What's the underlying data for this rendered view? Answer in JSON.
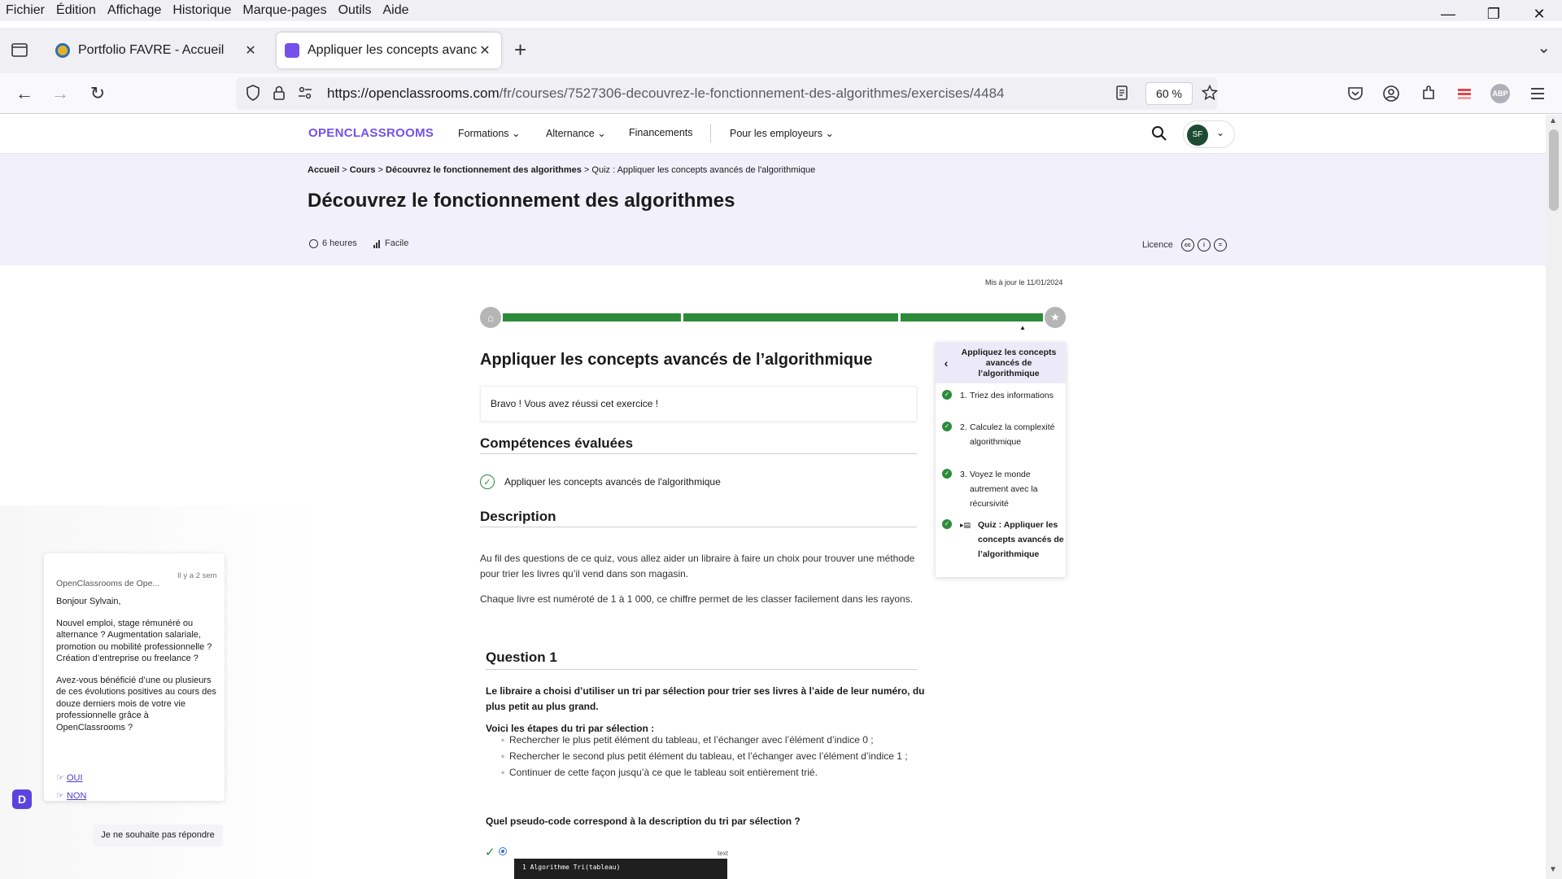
{
  "browser": {
    "menu": [
      "Fichier",
      "Édition",
      "Affichage",
      "Historique",
      "Marque-pages",
      "Outils",
      "Aide"
    ],
    "tabs": [
      {
        "title": "Portfolio FAVRE - Accueil",
        "favicon_color": "#e2b12a"
      },
      {
        "title": "Appliquer les concepts avancés",
        "favicon_color": "#7451eb"
      }
    ],
    "url_host": "https://openclassrooms.com",
    "url_path": "/fr/courses/7527306-decouvrez-le-fonctionnement-des-algorithmes/exercises/4484",
    "zoom": "60 %",
    "ext_label": "ABP"
  },
  "site": {
    "logo": "OPENCLASSROOMS",
    "nav": [
      "Formations",
      "Alternance",
      "Financements",
      "Pour les employeurs"
    ],
    "avatar": "SF",
    "brand_color": "#7451eb"
  },
  "hero": {
    "crumb_accueil": "Accueil",
    "crumb_cours": "Cours",
    "crumb_course": "Découvrez le fonctionnement des algorithmes",
    "crumb_current": "Quiz : Appliquer les concepts avancés de l'algorithmique",
    "title": "Découvrez le fonctionnement des algorithmes",
    "duration": "6 heures",
    "level": "Facile",
    "licence": "Licence"
  },
  "exercise": {
    "updated": "Mis à jour le 11/01/2024",
    "progress_segments": 3,
    "title": "Appliquer les concepts avancés de l’algorithmique",
    "success": "Bravo ! Vous avez réussi cet exercice !",
    "skills_heading": "Compétences évaluées",
    "skill": "Appliquer les concepts avancés de l'algorithmique",
    "description_heading": "Description",
    "description_1": "Au fil des questions de ce quiz, vous allez aider un libraire à faire un choix pour trouver une méthode pour trier les livres qu’il vend dans son magasin.",
    "description_2": "Chaque livre est numéroté de 1 à 1 000, ce chiffre permet de les classer facilement dans les rayons.",
    "question_title": "Question 1",
    "question_intro": "Le libraire a choisi d’utiliser un tri par sélection pour trier ses livres à l’aide de leur numéro, du plus petit au plus grand.",
    "steps_label": "Voici les étapes du tri par sélection :",
    "steps": [
      "Rechercher le plus petit élément du tableau, et l’échanger avec l’élément d’indice 0 ;",
      "Rechercher le second plus petit élément du tableau, et l’échanger avec l’élément d’indice 1 ;",
      "Continuer de cette façon jusqu’à ce que le tableau soit entièrement trié."
    ],
    "question": "Quel pseudo-code correspond à la description du tri par sélection ?",
    "code_label": "text",
    "code_line": "1  Algorithme Tri(tableau)"
  },
  "sidebar": {
    "heading": "Appliquez les concepts avancés de l’algorithmique",
    "items": [
      {
        "num": "1.",
        "label": "Triez des informations"
      },
      {
        "num": "2.",
        "label": "Calculez la complexité algorithmique"
      },
      {
        "num": "3.",
        "label": "Voyez le monde autrement avec la récursivité"
      },
      {
        "num": "",
        "label": "Quiz : Appliquer les concepts avancés de l’algorithmique"
      }
    ]
  },
  "chat": {
    "from": "OpenClassrooms de Ope...",
    "when": "Il y a 2 sem",
    "greeting": "Bonjour Sylvain,",
    "p1": "Nouvel emploi, stage rémunéré ou alternance ? Augmentation salariale, promotion ou mobilité professionnelle ? Création d’entreprise ou freelance ?",
    "p2": "Avez-vous bénéficié d’une ou plusieurs de ces évolutions positives au cours des douze derniers mois de votre vie professionnelle grâce à OpenClassrooms ?",
    "yes": "OUI",
    "no": "NON",
    "reply": "Je ne souhaite pas répondre"
  }
}
